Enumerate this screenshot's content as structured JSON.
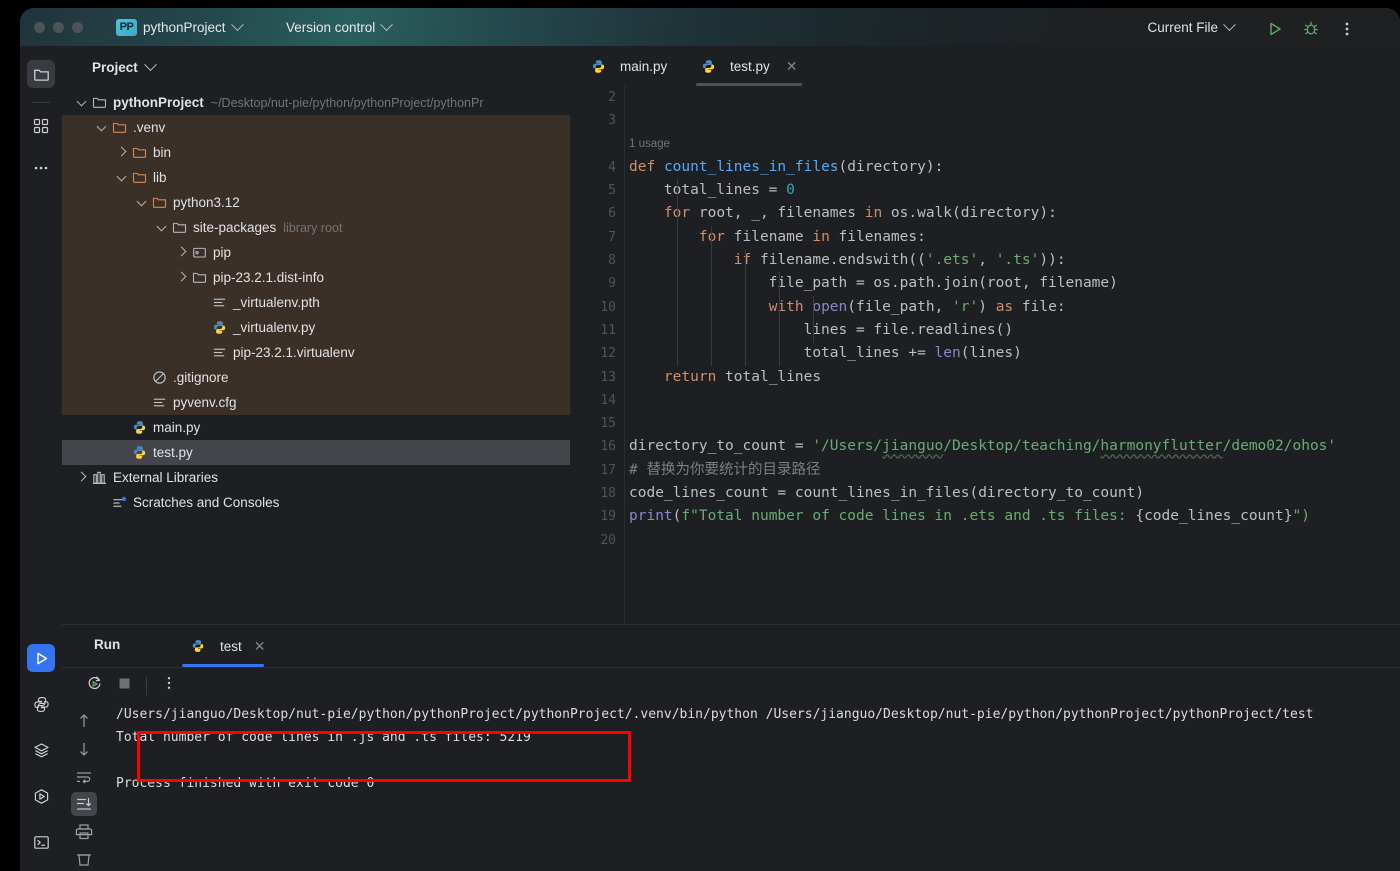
{
  "titlebar": {
    "project_badge": "PP",
    "project_name": "pythonProject",
    "version_control": "Version control",
    "run_config": "Current File",
    "icons": [
      "run-icon",
      "debug-icon",
      "more-options-icon"
    ]
  },
  "rail": {
    "top_items": [
      {
        "name": "project-tool-window",
        "icon": "folder-icon",
        "selected": true
      },
      {
        "name": "structure-tool-window",
        "icon": "grid-squares-icon",
        "selected": false
      },
      {
        "name": "more-tool-windows",
        "icon": "ellipsis-icon",
        "selected": false
      }
    ],
    "bottom_items": [
      {
        "name": "run-tool-window",
        "icon": "play-triangle-icon",
        "selected": true
      },
      {
        "name": "python-packages",
        "icon": "python-icon",
        "selected": false
      },
      {
        "name": "services",
        "icon": "layers-icon",
        "selected": false
      },
      {
        "name": "run-anything",
        "icon": "hexagon-play-icon",
        "selected": false
      },
      {
        "name": "terminal",
        "icon": "terminal-icon",
        "selected": false
      }
    ]
  },
  "project": {
    "title": "Project",
    "tree": [
      {
        "label": "pythonProject",
        "note": "~/Desktop/nut-pie/python/pythonProject/pythonPr",
        "icon": "folder-icon",
        "arrow": "down",
        "indent": 0,
        "bold": true,
        "highlight": false,
        "selected": false
      },
      {
        "label": ".venv",
        "note": "",
        "icon": "folder-orange-icon",
        "arrow": "down",
        "indent": 1,
        "bold": false,
        "highlight": true,
        "selected": false
      },
      {
        "label": "bin",
        "note": "",
        "icon": "folder-orange-icon",
        "arrow": "right",
        "indent": 2,
        "bold": false,
        "highlight": true,
        "selected": false
      },
      {
        "label": "lib",
        "note": "",
        "icon": "folder-orange-icon",
        "arrow": "down",
        "indent": 2,
        "bold": false,
        "highlight": true,
        "selected": false
      },
      {
        "label": "python3.12",
        "note": "",
        "icon": "folder-orange-icon",
        "arrow": "down",
        "indent": 3,
        "bold": false,
        "highlight": true,
        "selected": false
      },
      {
        "label": "site-packages",
        "note": "library root",
        "icon": "folder-icon",
        "arrow": "down",
        "indent": 4,
        "bold": false,
        "highlight": true,
        "selected": false
      },
      {
        "label": "pip",
        "note": "",
        "icon": "package-folder-icon",
        "arrow": "right",
        "indent": 5,
        "bold": false,
        "highlight": true,
        "selected": false
      },
      {
        "label": "pip-23.2.1.dist-info",
        "note": "",
        "icon": "folder-icon",
        "arrow": "right",
        "indent": 5,
        "bold": false,
        "highlight": true,
        "selected": false
      },
      {
        "label": "_virtualenv.pth",
        "note": "",
        "icon": "text-file-icon",
        "arrow": "none",
        "indent": 6,
        "bold": false,
        "highlight": true,
        "selected": false
      },
      {
        "label": "_virtualenv.py",
        "note": "",
        "icon": "python-file-icon",
        "arrow": "none",
        "indent": 6,
        "bold": false,
        "highlight": true,
        "selected": false
      },
      {
        "label": "pip-23.2.1.virtualenv",
        "note": "",
        "icon": "text-file-icon",
        "arrow": "none",
        "indent": 6,
        "bold": false,
        "highlight": true,
        "selected": false
      },
      {
        "label": ".gitignore",
        "note": "",
        "icon": "gitignore-icon",
        "arrow": "none",
        "indent": 3,
        "bold": false,
        "highlight": true,
        "selected": false
      },
      {
        "label": "pyvenv.cfg",
        "note": "",
        "icon": "text-file-icon",
        "arrow": "none",
        "indent": 3,
        "bold": false,
        "highlight": true,
        "selected": false
      },
      {
        "label": "main.py",
        "note": "",
        "icon": "python-file-icon",
        "arrow": "none",
        "indent": 2,
        "bold": false,
        "highlight": false,
        "selected": false
      },
      {
        "label": "test.py",
        "note": "",
        "icon": "python-file-icon",
        "arrow": "none",
        "indent": 2,
        "bold": false,
        "highlight": false,
        "selected": true
      },
      {
        "label": "External Libraries",
        "note": "",
        "icon": "library-icon",
        "arrow": "right",
        "indent": 0,
        "bold": false,
        "highlight": false,
        "selected": false
      },
      {
        "label": "Scratches and Consoles",
        "note": "",
        "icon": "scratches-icon",
        "arrow": "none",
        "indent": 1,
        "bold": false,
        "highlight": false,
        "selected": false
      }
    ]
  },
  "editor": {
    "tabs": [
      {
        "label": "main.py",
        "icon": "python-file-icon",
        "active": false,
        "closable": false
      },
      {
        "label": "test.py",
        "icon": "python-file-icon",
        "active": true,
        "closable": true
      }
    ],
    "first_line_number": 2,
    "usage_hint": "1 usage",
    "line_numbers": [
      2,
      3,
      4,
      5,
      6,
      7,
      8,
      9,
      10,
      11,
      12,
      13,
      14,
      15,
      16,
      17,
      18,
      19,
      20
    ],
    "code_lines": [
      {
        "n": 2,
        "html": ""
      },
      {
        "n": 3,
        "html": ""
      },
      {
        "n": 4,
        "html": "<span class='kw'>def</span> <span class='fn'>count_lines_in_files</span>(directory):"
      },
      {
        "n": 5,
        "html": "    total_lines = <span class='num'>0</span>"
      },
      {
        "n": 6,
        "html": "    <span class='kw'>for</span> root, _, filenames <span class='kw'>in</span> os.walk(directory):"
      },
      {
        "n": 7,
        "html": "        <span class='kw'>for</span> filename <span class='kw'>in</span> filenames:"
      },
      {
        "n": 8,
        "html": "            <span class='kw'>if</span> filename.endswith((<span class='str'>'.ets'</span>, <span class='str'>'.ts'</span>)):"
      },
      {
        "n": 9,
        "html": "                file_path = os.path.join(root, filename)"
      },
      {
        "n": 10,
        "html": "                <span class='kw'>with</span> <span class='bi'>open</span>(file_path, <span class='str'>'r'</span>) <span class='kw'>as</span> file:"
      },
      {
        "n": 11,
        "html": "                    lines = file.readlines()"
      },
      {
        "n": 12,
        "html": "                    total_lines += <span class='bi'>len</span>(lines)"
      },
      {
        "n": 13,
        "html": "    <span class='kw'>return</span> total_lines"
      },
      {
        "n": 14,
        "html": ""
      },
      {
        "n": 15,
        "html": ""
      },
      {
        "n": 16,
        "html": "directory_to_count = <span class='str'>'/Users/<span class='wavy'>jianguo</span>/Desktop/teaching/<span class='wavy'>harmonyflutter</span>/demo02/ohos'</span>"
      },
      {
        "n": 17,
        "html": "<span class='cmt'># 替换为你要统计的目录路径</span>"
      },
      {
        "n": 18,
        "html": "code_lines_count = count_lines_in_files(directory_to_count)"
      },
      {
        "n": 19,
        "html": "<span class='bi'>print</span>(<span class='str'>f\"Total number of code lines in .ets and .ts files: </span>{code_lines_count}<span class='str'>\")</span>"
      },
      {
        "n": 20,
        "html": ""
      }
    ],
    "code_plain": [
      "",
      "",
      "def count_lines_in_files(directory):",
      "    total_lines = 0",
      "    for root, _, filenames in os.walk(directory):",
      "        for filename in filenames:",
      "            if filename.endswith(('.ets', '.ts')):",
      "                file_path = os.path.join(root, filename)",
      "                with open(file_path, 'r') as file:",
      "                    lines = file.readlines()",
      "                    total_lines += len(lines)",
      "    return total_lines",
      "",
      "",
      "directory_to_count = '/Users/jianguo/Desktop/teaching/harmonyflutter/demo02/ohos'",
      "# 替换为你要统计的目录路径",
      "code_lines_count = count_lines_in_files(directory_to_count)",
      "print(f\"Total number of code lines in .ets and .ts files: {code_lines_count}\")",
      ""
    ]
  },
  "run_panel": {
    "title": "Run",
    "tab_label": "test",
    "tab_icon": "python-file-icon",
    "toolbar_icons": [
      "rerun-icon",
      "stop-icon",
      "more-options-icon"
    ],
    "gutter_icons": [
      "scroll-up-icon",
      "scroll-down-icon",
      "soft-wrap-icon",
      "scroll-to-end-icon",
      "print-icon",
      "clear-all-icon"
    ],
    "console_lines": [
      "/Users/jianguo/Desktop/nut-pie/python/pythonProject/pythonProject/.venv/bin/python /Users/jianguo/Desktop/nut-pie/python/pythonProject/pythonProject/test",
      "Total number of code lines in .js and .ts files: 5219",
      "",
      "Process finished with exit code 0"
    ],
    "highlight_color": "#ff0000",
    "result_value": "5219"
  }
}
